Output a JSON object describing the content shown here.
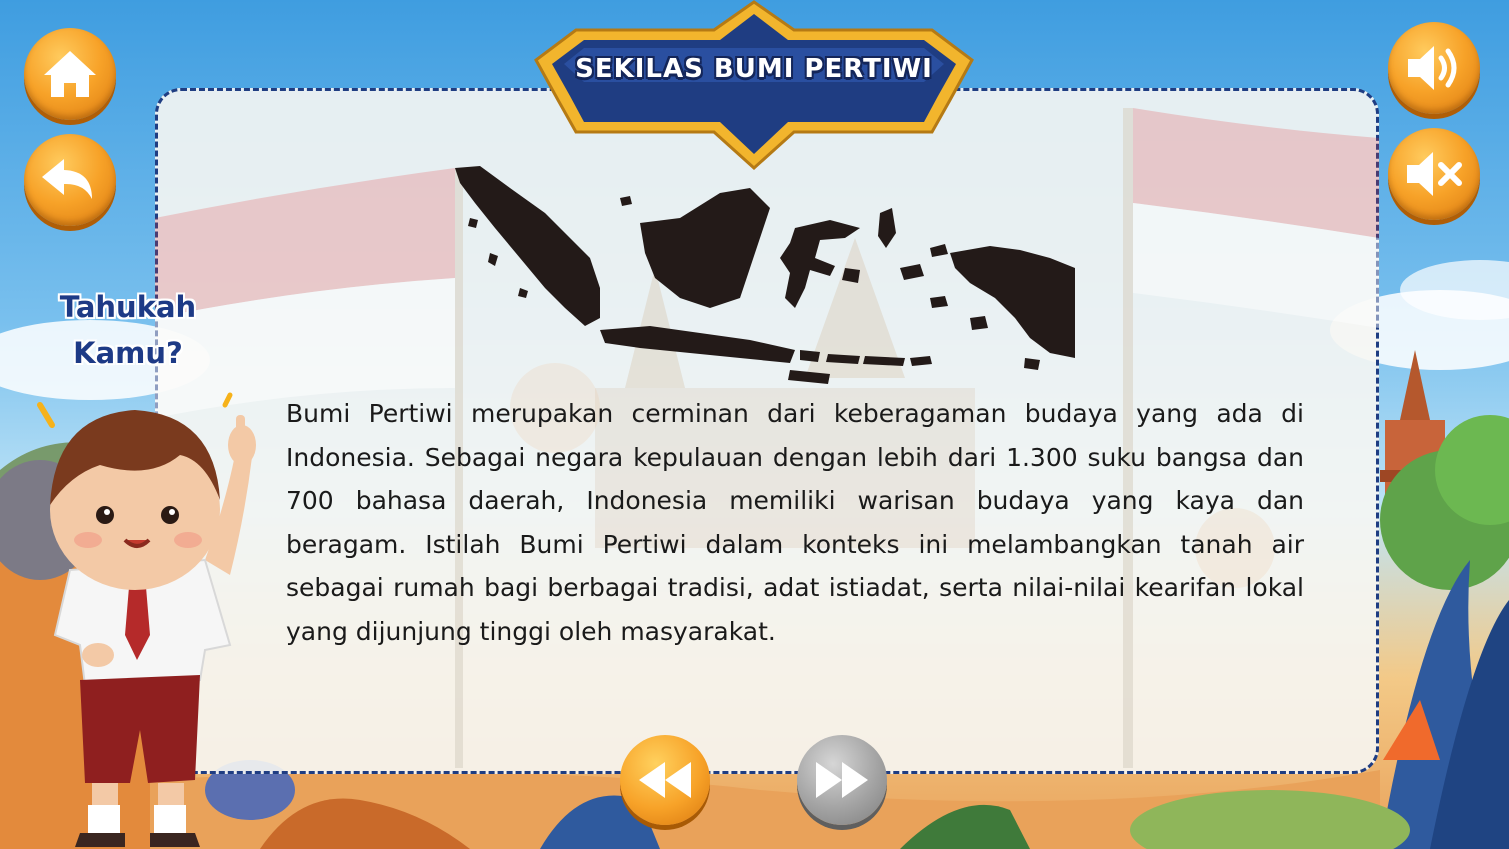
{
  "banner": {
    "title": "SEKILAS BUMI PERTIWI"
  },
  "side_label": {
    "line1": "Tahukah",
    "line2": "Kamu?"
  },
  "body_text": "Bumi Pertiwi merupakan cerminan dari keberagaman budaya yang ada di Indonesia. Sebagai negara kepulauan dengan lebih dari 1.300 suku bangsa dan 700 bahasa daerah, Indonesia memiliki warisan budaya yang kaya dan beragam. Istilah Bumi Pertiwi dalam konteks ini melambangkan tanah air sebagai rumah bagi berbagai tradisi, adat istiadat, serta nilai-nilai kearifan lokal yang dijunjung tinggi oleh masyarakat.",
  "icons": {
    "home": "home-icon",
    "back": "back-arrow-icon",
    "sound_on": "speaker-icon",
    "sound_off": "mute-icon",
    "prev": "rewind-icon",
    "next": "fast-forward-icon"
  },
  "colors": {
    "accent_orange": "#f7a228",
    "banner_blue": "#1f3d82",
    "banner_gold": "#f2b52d",
    "flag_red": "#e23a3a",
    "disabled_grey": "#a3a3a3"
  }
}
